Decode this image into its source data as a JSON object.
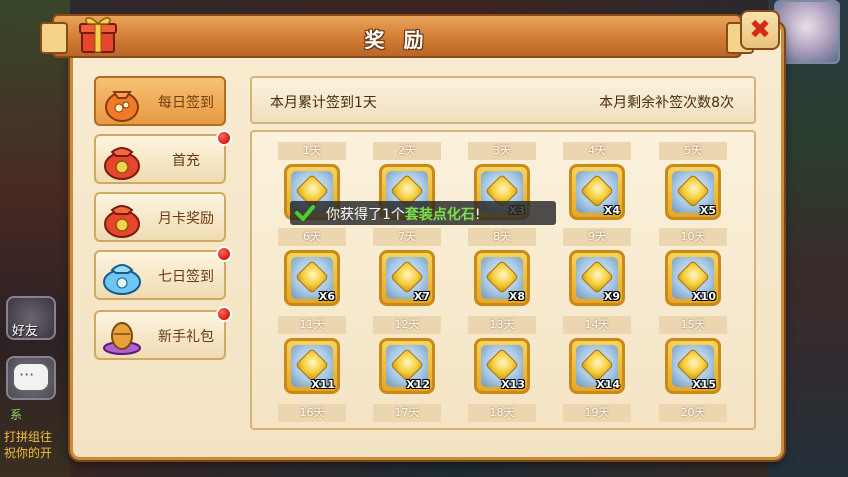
{
  "dialog": {
    "title": "奖 励",
    "close_label": "✖"
  },
  "menu": [
    {
      "label": "每日签到",
      "icon": "pouch-icon",
      "active": true,
      "badge": false
    },
    {
      "label": "首充",
      "icon": "money-bag-icon",
      "active": false,
      "badge": true
    },
    {
      "label": "月卡奖励",
      "icon": "money-bag-icon",
      "active": false,
      "badge": false
    },
    {
      "label": "七日签到",
      "icon": "blue-bag-icon",
      "active": false,
      "badge": true
    },
    {
      "label": "新手礼包",
      "icon": "purple-egg-icon",
      "active": false,
      "badge": true
    }
  ],
  "info": {
    "left": "本月累计签到1天",
    "right": "本月剩余补签次数8次"
  },
  "days": [
    {
      "label": "1天",
      "qty": ""
    },
    {
      "label": "2天",
      "qty": ""
    },
    {
      "label": "3天",
      "qty": "X3"
    },
    {
      "label": "4天",
      "qty": "X4"
    },
    {
      "label": "5天",
      "qty": "X5"
    },
    {
      "label": "6天",
      "qty": "X6"
    },
    {
      "label": "7天",
      "qty": "X7"
    },
    {
      "label": "8天",
      "qty": "X8"
    },
    {
      "label": "9天",
      "qty": "X9"
    },
    {
      "label": "10天",
      "qty": "X10"
    },
    {
      "label": "11天",
      "qty": "X11"
    },
    {
      "label": "12天",
      "qty": "X12"
    },
    {
      "label": "13天",
      "qty": "X13"
    },
    {
      "label": "14天",
      "qty": "X14"
    },
    {
      "label": "15天",
      "qty": "X15"
    },
    {
      "label": "16天",
      "qty": ""
    },
    {
      "label": "17天",
      "qty": ""
    },
    {
      "label": "18天",
      "qty": ""
    },
    {
      "label": "19天",
      "qty": ""
    },
    {
      "label": "20天",
      "qty": ""
    }
  ],
  "toast": {
    "prefix": "你获得了1个",
    "item": "套装点化石",
    "suffix": "!"
  },
  "background": {
    "friend_label": "好友",
    "chat_line1": "系",
    "chat_line2": "打拼组往",
    "chat_line3": "祝你的开"
  }
}
